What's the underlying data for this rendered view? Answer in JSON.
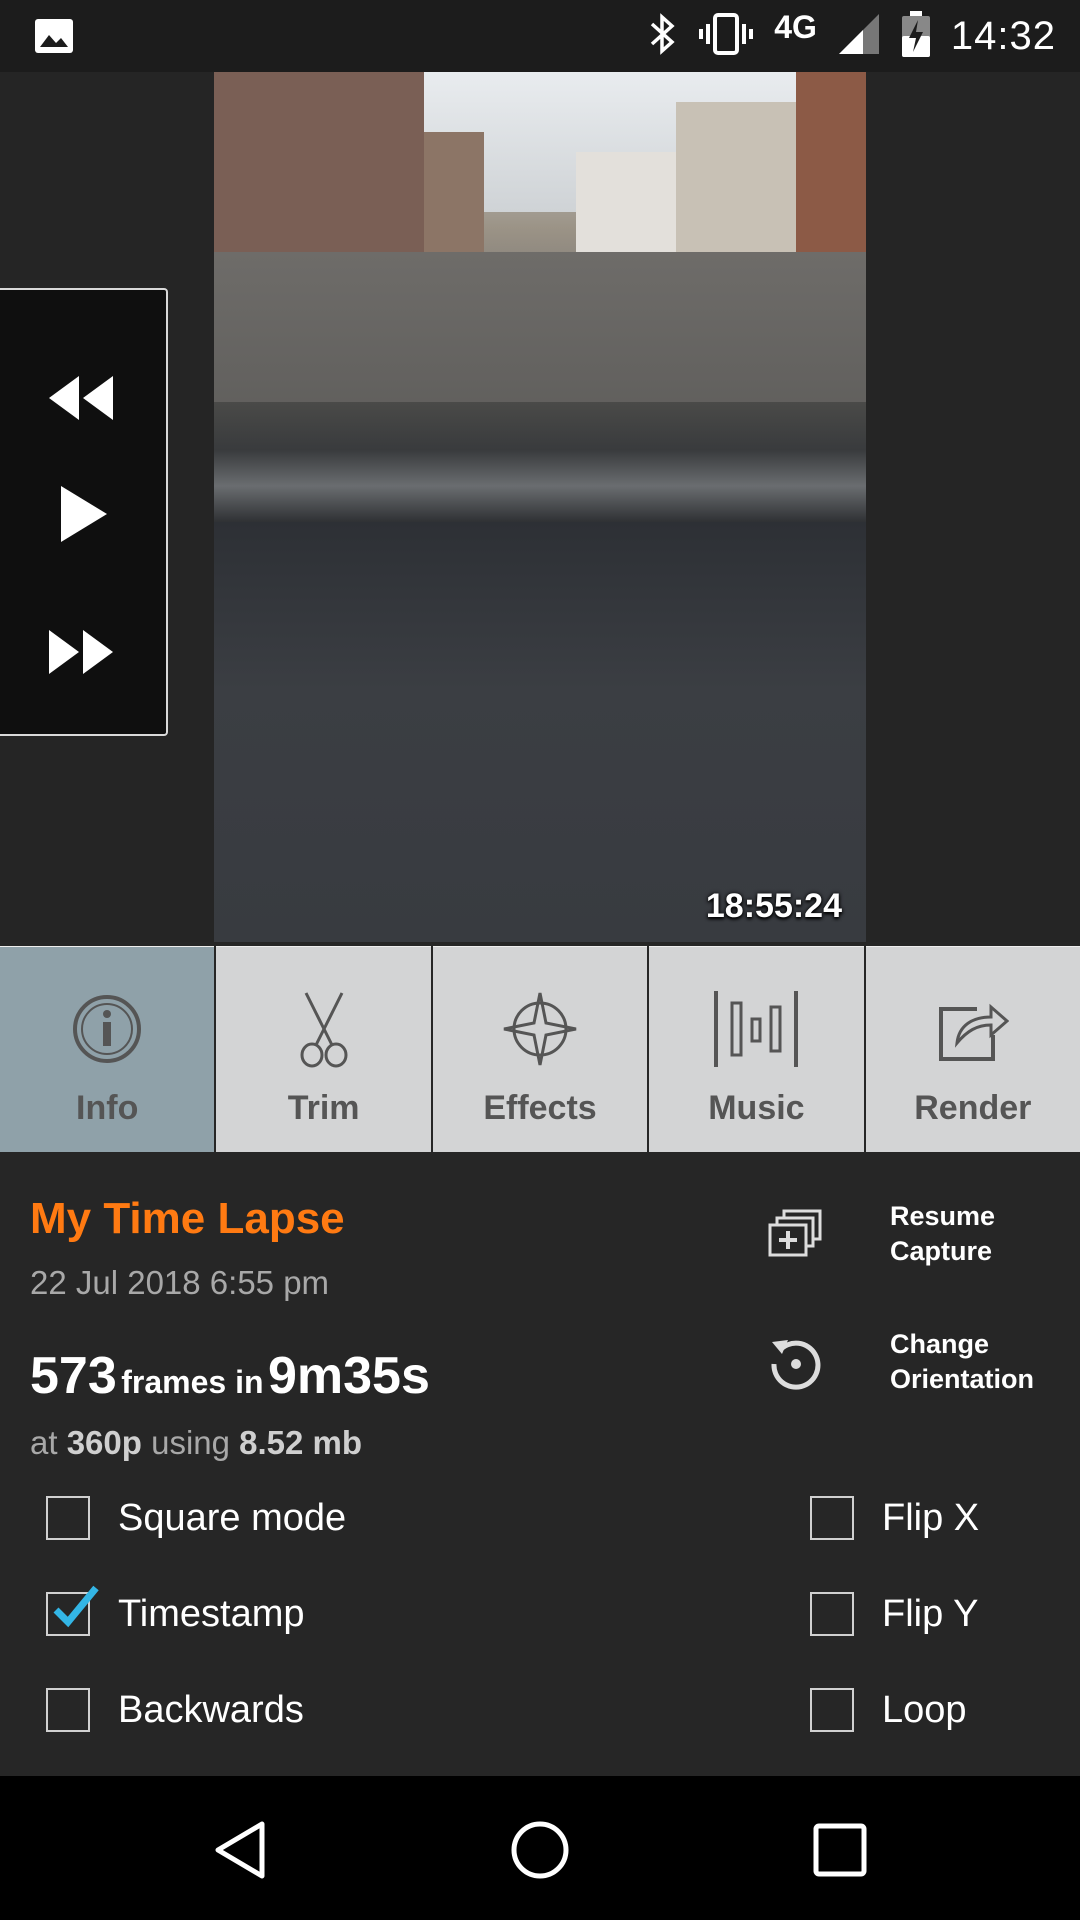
{
  "status_bar": {
    "network": "4G",
    "time": "14:32",
    "icons": [
      "image-icon",
      "bluetooth-icon",
      "vibrate-icon",
      "signal-icon",
      "battery-charging-icon"
    ]
  },
  "video": {
    "timestamp": "18:55:24",
    "controls": [
      "rewind-icon",
      "play-icon",
      "fast-forward-icon"
    ]
  },
  "tabs": [
    {
      "label": "Info",
      "icon": "info-icon",
      "active": true
    },
    {
      "label": "Trim",
      "icon": "scissors-icon",
      "active": false
    },
    {
      "label": "Effects",
      "icon": "effects-icon",
      "active": false
    },
    {
      "label": "Music",
      "icon": "music-icon",
      "active": false
    },
    {
      "label": "Render",
      "icon": "render-icon",
      "active": false
    }
  ],
  "info": {
    "title": "My Time Lapse",
    "date": "22 Jul 2018 6:55 pm",
    "frames_count": "573",
    "frames_text": "frames in",
    "duration": "9m35s",
    "res_prefix": "at",
    "resolution": "360p",
    "res_mid": "using",
    "size": "8.52 mb"
  },
  "actions": {
    "resume_line1": "Resume",
    "resume_line2": "Capture",
    "orientation_line1": "Change",
    "orientation_line2": "Orientation"
  },
  "options": {
    "square_mode": {
      "label": "Square mode",
      "checked": false
    },
    "timestamp": {
      "label": "Timestamp",
      "checked": true
    },
    "backwards": {
      "label": "Backwards",
      "checked": false
    },
    "flip_x": {
      "label": "Flip X",
      "checked": false
    },
    "flip_y": {
      "label": "Flip Y",
      "checked": false
    },
    "loop": {
      "label": "Loop",
      "checked": false
    }
  },
  "colors": {
    "accent": "#ff7a12",
    "check": "#33b5e5",
    "tab_active": "#8fa1a9",
    "tab_inactive": "#d3d4d5"
  }
}
